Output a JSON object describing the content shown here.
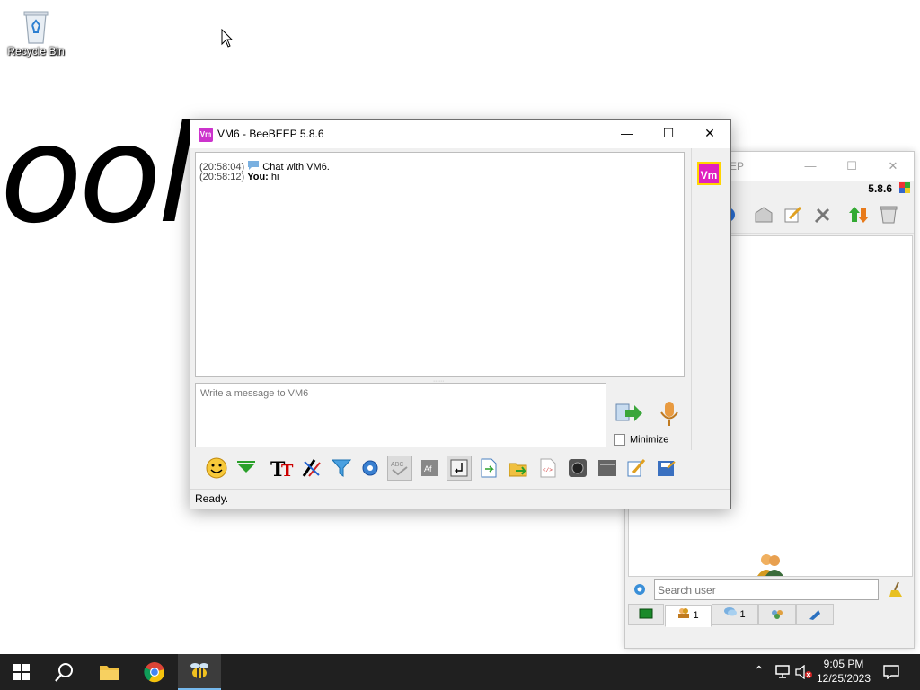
{
  "desktop": {
    "recycle_bin_label": "Recycle Bin",
    "background_text": "ool"
  },
  "main_window": {
    "title": "BEEP",
    "version": "5.8.6",
    "search_placeholder": "Search user",
    "tabs": [
      {
        "icon": "users-icon",
        "count": "1"
      },
      {
        "icon": "chat-bubbles-icon",
        "count": "1"
      },
      {
        "icon": "groups-icon",
        "count": ""
      },
      {
        "icon": "share-icon",
        "count": ""
      }
    ]
  },
  "chat_window": {
    "title": "VM6 - BeeBEEP 5.8.6",
    "app_icon_text": "Vm",
    "avatar_text": "Vm",
    "messages": [
      {
        "time": "(20:58:04)",
        "sender": "",
        "text": "Chat with VM6."
      },
      {
        "time": "(20:58:12)",
        "sender": "You:",
        "text": "hi"
      }
    ],
    "input_placeholder": "Write a message to VM6",
    "minimize_label": "Minimize",
    "status": "Ready."
  },
  "taskbar": {
    "time": "9:05 PM",
    "date": "12/25/2023"
  },
  "colors": {
    "accent": "#76b9ed",
    "avatar_bg": "#e020c0",
    "avatar_border": "#ffd400",
    "taskbar_bg": "#202020"
  }
}
